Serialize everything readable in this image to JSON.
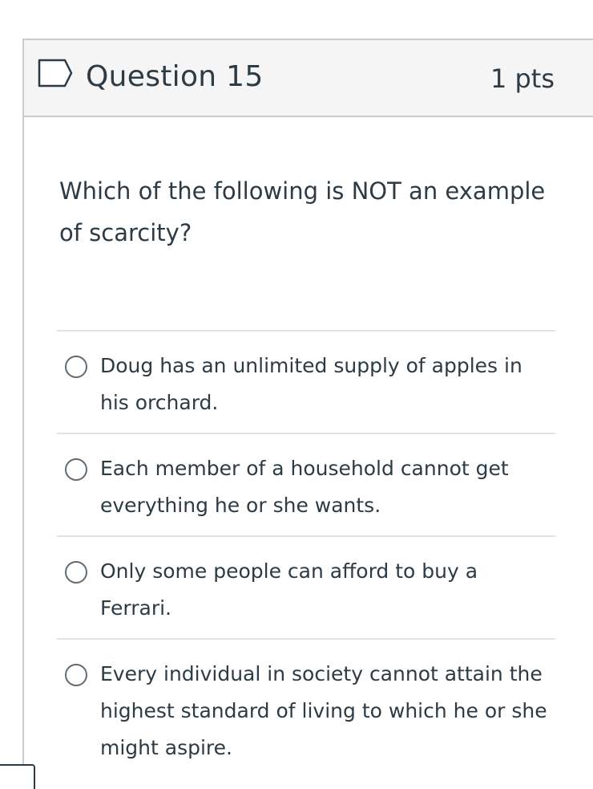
{
  "question": {
    "title": "Question 15",
    "points": "1 pts",
    "flag_icon": "flag-icon",
    "text": "Which of the following is NOT an example of scarcity?"
  },
  "answers": [
    {
      "label": "Doug has an unlimited supply of apples in his orchard."
    },
    {
      "label": "Each member of a household cannot get everything he or she wants."
    },
    {
      "label": "Only some people can afford to buy a Ferrari."
    },
    {
      "label": "Every individual in society cannot attain the highest standard of living to which he or she might aspire."
    }
  ],
  "colors": {
    "text": "#2d3b45",
    "header_bg": "#f5f5f5",
    "border": "#c7cdd1",
    "divider": "#dfe3e6"
  }
}
